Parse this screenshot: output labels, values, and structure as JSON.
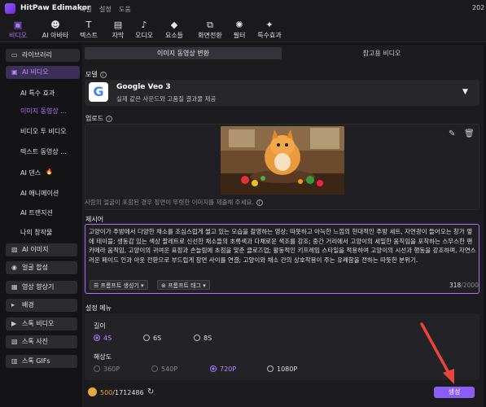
{
  "app": {
    "title": "HitPaw Edimakor",
    "menu": [
      "파일",
      "설정",
      "도움"
    ],
    "clock": "202"
  },
  "toolbar": [
    {
      "label": "비디오",
      "icon": "film-icon",
      "glyph": "▣",
      "active": true
    },
    {
      "label": "AI 아바타",
      "icon": "avatar-icon",
      "glyph": "☻",
      "active": false
    },
    {
      "label": "텍스트",
      "icon": "text-icon",
      "glyph": "T",
      "active": false
    },
    {
      "label": "자막",
      "icon": "subtitle-icon",
      "glyph": "▤",
      "active": false
    },
    {
      "label": "오디오",
      "icon": "music-icon",
      "glyph": "♪",
      "active": false
    },
    {
      "label": "요소들",
      "icon": "elements-icon",
      "glyph": "◆",
      "active": false
    },
    {
      "label": "화면전환",
      "icon": "transition-icon",
      "glyph": "⧉",
      "active": false
    },
    {
      "label": "필터",
      "icon": "filter-icon",
      "glyph": "✺",
      "active": false
    },
    {
      "label": "특수효과",
      "icon": "effects-icon",
      "glyph": "✦",
      "active": false
    }
  ],
  "sidebar": {
    "library": {
      "label": "라이브러리",
      "icon": "folder-icon",
      "glyph": "▭"
    },
    "ai_video": {
      "label": "AI 비디오",
      "icon": "ai-video-icon",
      "glyph": "▣"
    },
    "subs": [
      "AI 특수 효과",
      "이미지 동영상 ...",
      "비디오 투 비디오",
      "텍스트 동영상 ...",
      "AI 댄스",
      "AI 애니메이션",
      "AI 트랜지션",
      "나의 창작물"
    ],
    "active_sub": 1,
    "sections": [
      {
        "label": "AI 이미지",
        "icon": "ai-image-icon",
        "glyph": "▨"
      },
      {
        "label": "얼굴 합성",
        "icon": "face-swap-icon",
        "glyph": "◉"
      },
      {
        "label": "영상 향상기",
        "icon": "enhance-icon",
        "glyph": "▦"
      },
      {
        "label": "배경",
        "icon": "background-icon",
        "glyph": "▸"
      },
      {
        "label": "스톡 비디오",
        "icon": "stock-video-icon",
        "glyph": "▶"
      },
      {
        "label": "스톡 사진",
        "icon": "stock-photo-icon",
        "glyph": "▧"
      },
      {
        "label": "스톡 GIFs",
        "icon": "gif-icon",
        "glyph": "▥"
      }
    ]
  },
  "tabs": [
    "이미지 동영상 변환",
    "참고용 비디오"
  ],
  "model": {
    "section_label": "모델",
    "name": "Google Veo 3",
    "description": "실제 같은 사운드와 고품질 결과물 제공"
  },
  "upload": {
    "section_label": "업로드",
    "hint": "사람의 얼굴이 포함된 경우 정면이 뚜렷한 이미지를 제출해 주세요."
  },
  "prompt": {
    "section_label": "제시어",
    "text": "고양이가 주방에서 다양한 채소를 조심스럽게 썰고 있는 모습을 촬영하는 영상; 따뜻하고 아늑한 느낌의 현대적인 주방 세트, 자연광이 들어오는 창가 옆에 테이블; 생동감 있는 색상 팔레트로 신선한 채소들의 초록색과 다채로운 색조를 강조; 중간 거리에서 고양이의 세밀한 움직임을 포착하는 스무스한 팬 카메라 움직임, 고양이의 귀여운 표정과 손놀림에 초점을 맞춘 클로즈업; 활동적인 키프레임 스타일을 적용하여 고양이의 시선과 행동을 강조하며, 자연스러운 페이드 인과 아웃 전환으로 부드럽게 장면 사이를 연결; 고양이와 채소 간의 상호작용이 주는 유쾌함을 전하는 따뜻한 분위기.",
    "generator_label": "프롬프트 생성기",
    "tag_label": "프롬프트 태그",
    "count": "318",
    "max": "/2000"
  },
  "settings": {
    "section_label": "설정 메뉴",
    "duration_label": "길이",
    "durations": [
      "4S",
      "6S",
      "8S"
    ],
    "duration_selected": 0,
    "resolution_label": "해상도",
    "resolutions": [
      "360P",
      "540P",
      "720P",
      "1080P"
    ],
    "resolution_selected": 2
  },
  "footer": {
    "credits_used": "500",
    "credits_total": "/1712486",
    "generate_label": "생성"
  },
  "colors": {
    "accent": "#a873ff",
    "background": "#141416",
    "panel": "#1c1c1f",
    "arrow": "#e8463a"
  }
}
